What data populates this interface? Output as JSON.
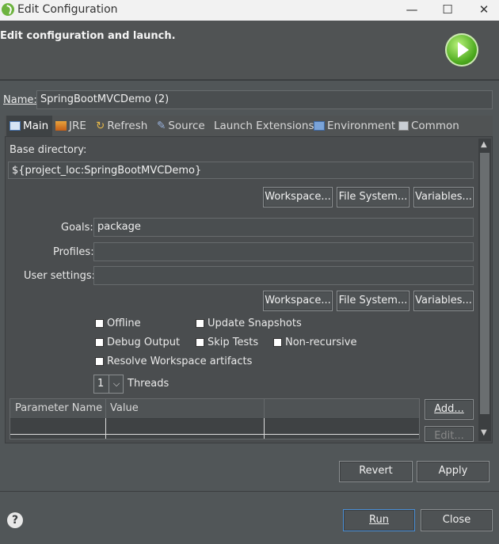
{
  "window": {
    "title": "Edit Configuration",
    "min": "—",
    "max": "☐",
    "close": "✕"
  },
  "header": {
    "title": "Edit configuration and launch."
  },
  "name_field": {
    "label": "Name:",
    "value": "SpringBootMVCDemo (2)"
  },
  "tabs": [
    {
      "label": "Main"
    },
    {
      "label": "JRE"
    },
    {
      "label": "Refresh"
    },
    {
      "label": "Source"
    },
    {
      "label": "Launch Extensions"
    },
    {
      "label": "Environment"
    },
    {
      "label": "Common"
    }
  ],
  "main": {
    "base_dir_label": "Base directory:",
    "base_dir_value": "${project_loc:SpringBootMVCDemo}",
    "buttons1": {
      "workspace": "Workspace...",
      "filesystem": "File System...",
      "variables": "Variables..."
    },
    "goals_label": "Goals:",
    "goals_value": "package",
    "profiles_label": "Profiles:",
    "profiles_value": "",
    "user_settings_label": "User settings:",
    "user_settings_value": "",
    "buttons2": {
      "workspace": "Workspace...",
      "filesystem": "File System...",
      "variables": "Variables..."
    },
    "checkboxes": {
      "offline": "Offline",
      "update_snapshots": "Update Snapshots",
      "debug_output": "Debug Output",
      "skip_tests": "Skip Tests",
      "non_recursive": "Non-recursive",
      "resolve_ws": "Resolve Workspace artifacts"
    },
    "threads_value": "1",
    "threads_label": "Threads",
    "table": {
      "col1": "Parameter Name",
      "col2": "Value"
    },
    "add_button": "Add...",
    "edit_button": "Edit..."
  },
  "footer": {
    "revert": "Revert",
    "apply": "Apply",
    "run": "Run",
    "close": "Close",
    "help": "?"
  }
}
